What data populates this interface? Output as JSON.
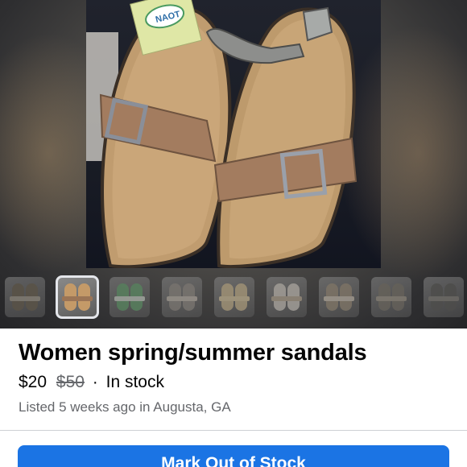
{
  "listing": {
    "title": "Women spring/summer sandals",
    "price": "$20",
    "original_price": "$50",
    "separator": "·",
    "availability": "In stock",
    "listed_text": "Listed 5 weeks ago in Augusta, GA"
  },
  "photo": {
    "subject": "sandals-photo",
    "tag_brand_text": "NAOT"
  },
  "thumbnails": {
    "count": 9,
    "selected_index": 1,
    "palette": [
      {
        "sole": "#7d725f",
        "strap": "#b8b0a0"
      },
      {
        "sole": "#c49a68",
        "strap": "#9b7556"
      },
      {
        "sole": "#6fae79",
        "strap": "#dde6da"
      },
      {
        "sole": "#9e9891",
        "strap": "#cfc6bb"
      },
      {
        "sole": "#d8c49a",
        "strap": "#e9d6ab"
      },
      {
        "sole": "#ded8cf",
        "strap": "#c7b7a0"
      },
      {
        "sole": "#a99b86",
        "strap": "#ded3c2"
      },
      {
        "sole": "#8a8478",
        "strap": "#b3aa9a"
      },
      {
        "sole": "#6b6a66",
        "strap": "#97938b"
      }
    ]
  },
  "actions": {
    "mark_out_of_stock_label": "Mark Out of Stock"
  },
  "colors": {
    "button_blue": "#1b74e4",
    "text_primary": "#050505",
    "text_secondary": "#65676b"
  }
}
